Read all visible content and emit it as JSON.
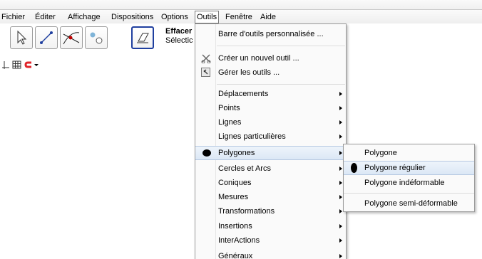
{
  "menubar": {
    "items": [
      "Fichier",
      "Éditer",
      "Affichage",
      "Dispositions",
      "Options",
      "Outils",
      "Fenêtre",
      "Aide"
    ],
    "active": "Outils"
  },
  "toolbar": {
    "tool_icons": [
      "move-arrow-icon",
      "line-segment-icon",
      "intersect-point-icon",
      "show-hide-object-icon",
      "eraser-icon"
    ],
    "current_tool_name": "Effacer",
    "current_tool_desc": "Sélectic"
  },
  "stylebar": {
    "icons": [
      "axes-icon",
      "grid-icon",
      "magnet-icon",
      "dropdown-triangle-icon"
    ]
  },
  "outils_menu": {
    "items": [
      {
        "label": "Barre d'outils personnalisée ...",
        "submenu": false
      },
      {
        "label": "Créer un nouvel outil ...",
        "submenu": false,
        "icon": "scissors-tool-icon"
      },
      {
        "label": "Gérer les outils ...",
        "submenu": false,
        "icon": "manage-tools-icon"
      },
      {
        "label": "Déplacements",
        "submenu": true
      },
      {
        "label": "Points",
        "submenu": true
      },
      {
        "label": "Lignes",
        "submenu": true
      },
      {
        "label": "Lignes particulières",
        "submenu": true
      },
      {
        "label": "Polygones",
        "submenu": true,
        "highlighted": true
      },
      {
        "label": "Cercles et Arcs",
        "submenu": true
      },
      {
        "label": "Coniques",
        "submenu": true
      },
      {
        "label": "Mesures",
        "submenu": true
      },
      {
        "label": "Transformations",
        "submenu": true
      },
      {
        "label": "Insertions",
        "submenu": true
      },
      {
        "label": "InterActions",
        "submenu": true
      },
      {
        "label": "Généraux",
        "submenu": true
      }
    ]
  },
  "polygones_submenu": {
    "items": [
      {
        "label": "Polygone"
      },
      {
        "label": "Polygone régulier",
        "highlighted": true
      },
      {
        "label": "Polygone indéformable"
      },
      {
        "label": "Polygone semi-déformable"
      }
    ]
  },
  "colors": {
    "highlight": "#dbe7f5",
    "selected_tool_border": "#1f3f9f",
    "magnet_red": "#e0242a"
  }
}
